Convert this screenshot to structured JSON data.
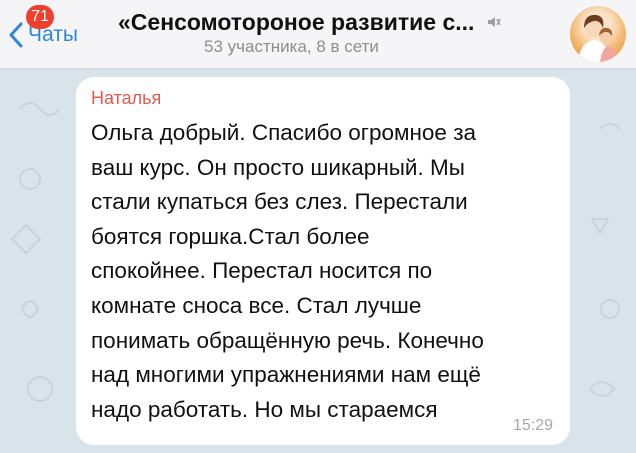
{
  "header": {
    "back_label": "Чаты",
    "unread_count": "71",
    "title": "«Сенсомотороное развитие с...",
    "subtitle": "53 участника, 8 в сети"
  },
  "message": {
    "sender": "Наталья",
    "text": "Ольга добрый. Спасибо огромное за\nваш курс. Он просто шикарный. Мы\nстали купаться без слез. Перестали\nбоятся горшка.Стал более\nспокойнее. Перестал носится по\nкомнате сноса все. Стал лучше\nпонимать обращённую речь. Конечно\nнад многими упражнениями нам ещё\nнадо работать.  Но мы стараемся",
    "time": "15:29"
  },
  "colors": {
    "accent": "#2e86de",
    "badge": "#ef3f2f",
    "sender_name": "#e05b4f",
    "chat_background": "#d9e3ea"
  },
  "icons": {
    "back": "chevron-left-icon",
    "mute": "muted-speaker-icon",
    "avatar": "group-avatar"
  }
}
